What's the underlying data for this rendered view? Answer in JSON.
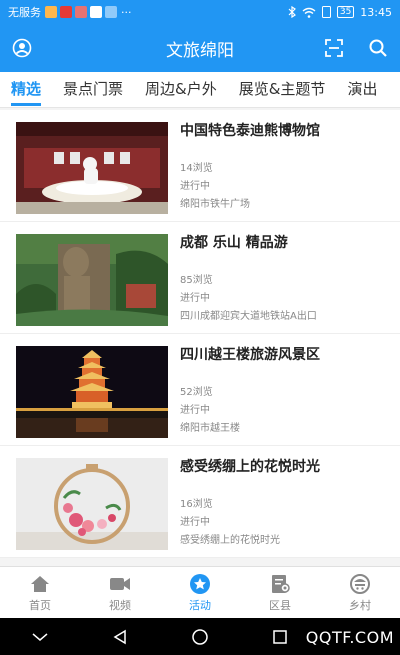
{
  "status": {
    "carrier": "无服务",
    "dots": "···",
    "battery": "35",
    "time": "13:45"
  },
  "app": {
    "title": "文旅绵阳"
  },
  "tabs": [
    {
      "label": "精选"
    },
    {
      "label": "景点门票"
    },
    {
      "label": "周边&户外"
    },
    {
      "label": "展览&主题节"
    },
    {
      "label": "演出"
    }
  ],
  "items": [
    {
      "title": "中国特色泰迪熊博物馆",
      "views": "14浏览",
      "status": "进行中",
      "location": "绵阳市铁牛广场"
    },
    {
      "title": "成都 乐山 精品游",
      "views": "85浏览",
      "status": "进行中",
      "location": "四川成都迎宾大道地铁站A出口"
    },
    {
      "title": "四川越王楼旅游风景区",
      "views": "52浏览",
      "status": "进行中",
      "location": "绵阳市越王楼"
    },
    {
      "title": "感受绣绷上的花悦时光",
      "views": "16浏览",
      "status": "进行中",
      "location": "感受绣绷上的花悦时光"
    }
  ],
  "nav": [
    {
      "label": "首页",
      "icon": "home-icon"
    },
    {
      "label": "视频",
      "icon": "video-icon"
    },
    {
      "label": "活动",
      "icon": "star-icon"
    },
    {
      "label": "区县",
      "icon": "map-icon"
    },
    {
      "label": "乡村",
      "icon": "village-icon"
    }
  ],
  "watermark": "QQTF.COM",
  "colors": {
    "primary": "#2196f3"
  }
}
